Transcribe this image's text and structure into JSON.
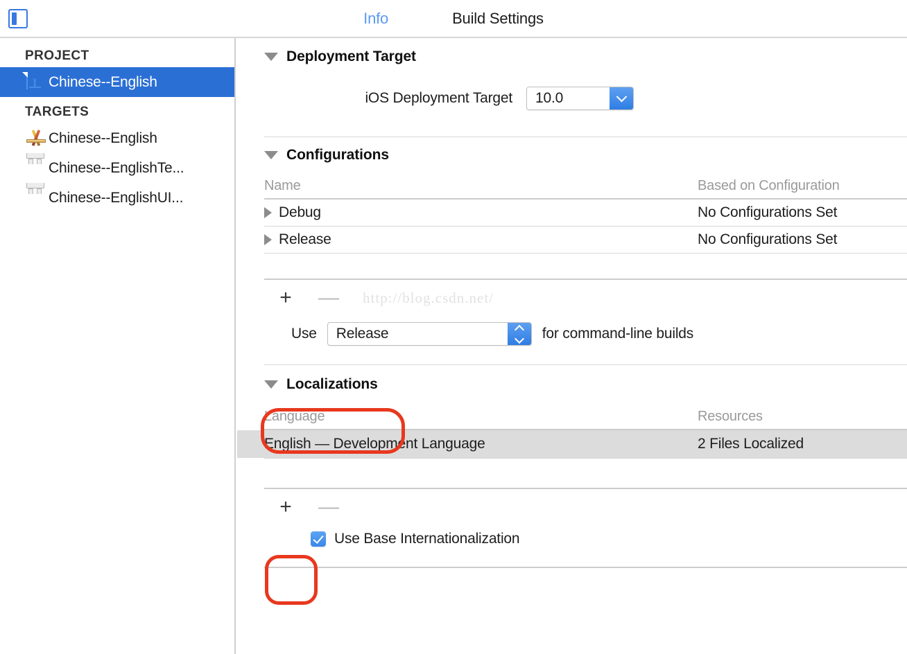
{
  "window": {
    "sidebar_toggle_icon": "sidebar-toggle-icon"
  },
  "tabs": [
    {
      "label": "Info",
      "active": true
    },
    {
      "label": "Build Settings",
      "active": false
    }
  ],
  "sidebar": {
    "project_group_label": "PROJECT",
    "targets_group_label": "TARGETS",
    "project_items": [
      {
        "label": "Chinese--English",
        "icon": "project-document-icon",
        "selected": true
      }
    ],
    "target_items": [
      {
        "label": "Chinese--English",
        "icon": "app-target-icon"
      },
      {
        "label": "Chinese--EnglishTe...",
        "icon": "bundle-target-icon"
      },
      {
        "label": "Chinese--EnglishUI...",
        "icon": "bundle-target-icon"
      }
    ]
  },
  "main": {
    "deployment_target": {
      "section_title": "Deployment Target",
      "disclosure_icon": "triangle-down-icon",
      "field_label": "iOS Deployment Target",
      "field_value": "10.0",
      "field_dropdown_icon": "chevron-down-icon"
    },
    "configurations": {
      "section_title": "Configurations",
      "disclosure_icon": "triangle-down-icon",
      "columns": [
        "Name",
        "Based on Configuration"
      ],
      "rows": [
        {
          "name": "Debug",
          "based_on": "No Configurations Set",
          "disclosure_icon": "triangle-right-icon"
        },
        {
          "name": "Release",
          "based_on": "No Configurations Set",
          "disclosure_icon": "triangle-right-icon"
        }
      ],
      "add_label": "+",
      "remove_label": "—",
      "watermark": "http://blog.csdn.net/",
      "command_line_prefix": "Use",
      "command_line_value": "Release",
      "command_line_suffix": "for command-line builds",
      "command_line_dropdown_icon": "chevron-up-down-icon"
    },
    "localizations": {
      "section_title": "Localizations",
      "disclosure_icon": "triangle-down-icon",
      "columns": [
        "Language",
        "Resources"
      ],
      "rows": [
        {
          "language": "English — Development Language",
          "resources": "2 Files Localized"
        }
      ],
      "add_label": "+",
      "remove_label": "—",
      "checkbox_label": "Use Base Internationalization",
      "checkbox_checked": true
    }
  },
  "annotations": {
    "color": "#e8381e",
    "items": [
      {
        "name": "localizations-header-highlight"
      },
      {
        "name": "localizations-add-button-highlight"
      }
    ]
  },
  "colors": {
    "accent_blue": "#2a6fd4",
    "tab_active": "#5b9bf2",
    "row_shaded": "#dcdcdc",
    "annotation_red": "#e8381e"
  }
}
